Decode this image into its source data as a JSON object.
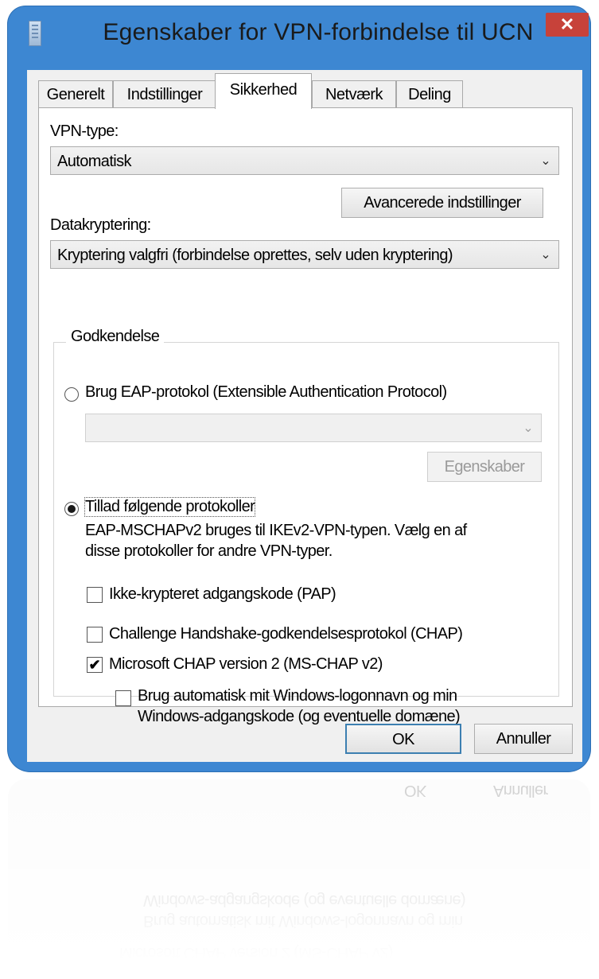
{
  "window": {
    "title": "Egenskaber for VPN-forbindelse til UCN",
    "close_glyph": "✕"
  },
  "tabs": [
    {
      "label": "Generelt"
    },
    {
      "label": "Indstillinger"
    },
    {
      "label": "Sikkerhed",
      "active": true
    },
    {
      "label": "Netværk"
    },
    {
      "label": "Deling"
    }
  ],
  "vpn_type": {
    "label": "VPN-type:",
    "value": "Automatisk"
  },
  "advanced_button": "Avancerede indstillinger",
  "encryption": {
    "label": "Datakryptering:",
    "value": "Kryptering valgfri (forbindelse oprettes, selv uden kryptering)"
  },
  "auth": {
    "group_title": "Godkendelse",
    "eap_radio_label": "Brug EAP-protokol (Extensible Authentication Protocol)",
    "eap_select_value": "",
    "properties_button": "Egenskaber",
    "allow_radio_label": "Tillad følgende protokoller",
    "note_line1": "EAP-MSCHAPv2 bruges til IKEv2-VPN-typen. Vælg en af",
    "note_line2": "disse protokoller for andre VPN-typer.",
    "pap_label": "Ikke-krypteret adgangskode (PAP)",
    "chap_label": "Challenge Handshake-godkendelsesprotokol (CHAP)",
    "mschap_label": "Microsoft CHAP version 2 (MS-CHAP v2)",
    "autologon_line1": "Brug automatisk mit Windows-logonnavn og min",
    "autologon_line2": "Windows-adgangskode (og eventuelle domæne)",
    "pap_checked": false,
    "chap_checked": false,
    "mschap_checked": true,
    "autologon_checked": false,
    "check_glyph": "✔"
  },
  "footer": {
    "ok": "OK",
    "cancel": "Annuller"
  },
  "colors": {
    "frame": "#3d87d2",
    "close": "#c7423a",
    "default_button_border": "#3c7fb1"
  }
}
